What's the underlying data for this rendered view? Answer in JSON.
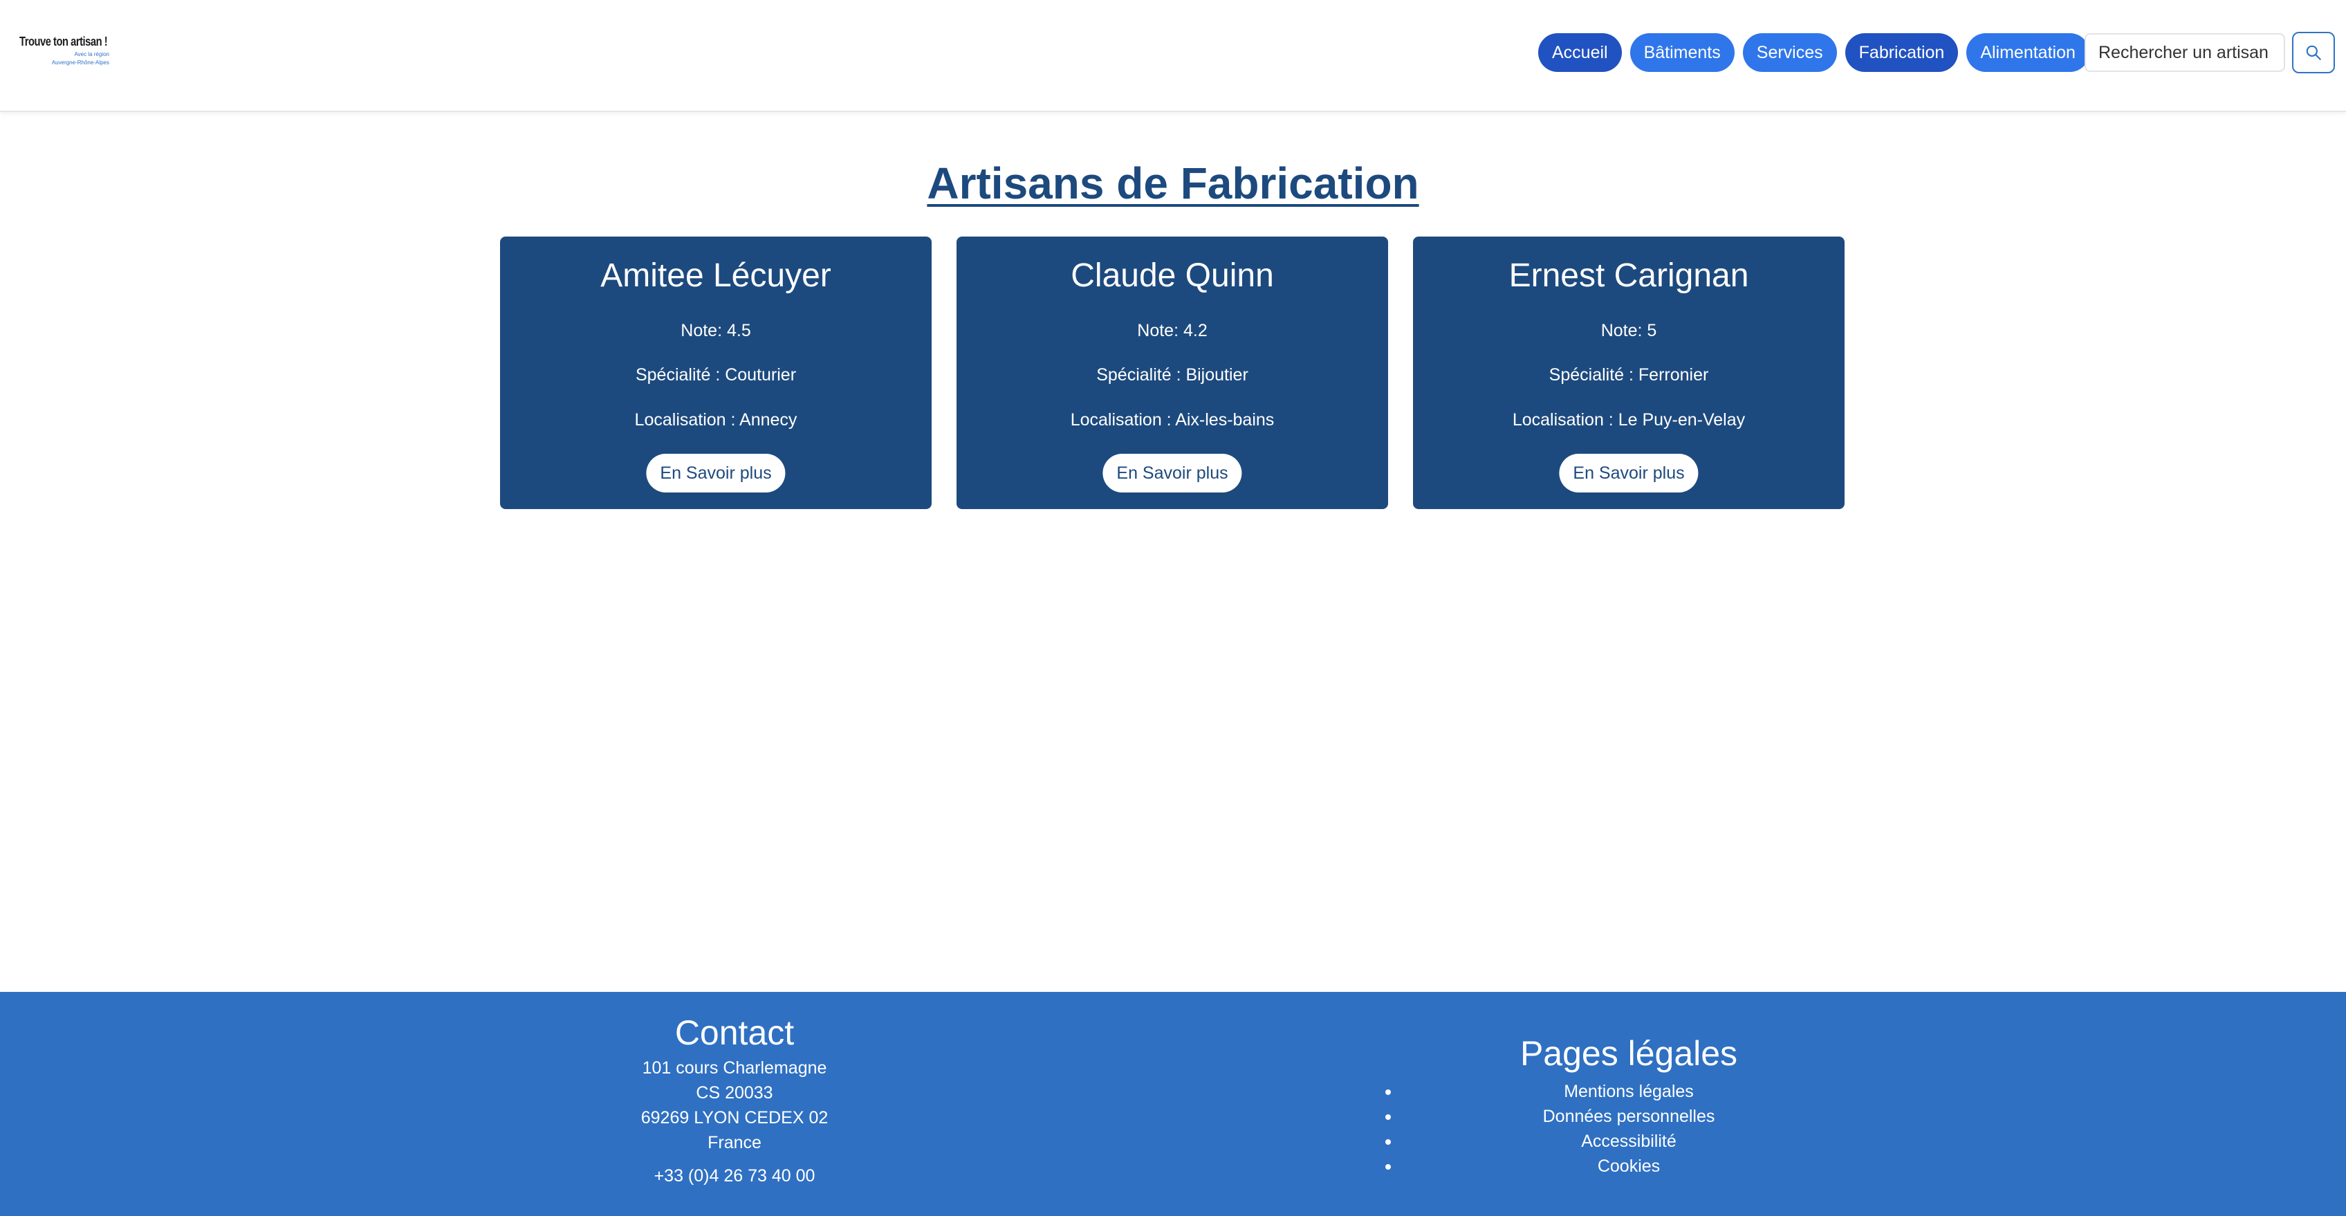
{
  "logo": {
    "title": "Trouve ton artisan !",
    "line1": "Avec la région",
    "line2": "Auvergne-Rhône-Alpes"
  },
  "nav": {
    "items": [
      {
        "label": "Accueil",
        "color": "#2152c1"
      },
      {
        "label": "Bâtiments",
        "color": "#2f76ea"
      },
      {
        "label": "Services",
        "color": "#2f76ea"
      },
      {
        "label": "Fabrication",
        "color": "#2152c1"
      },
      {
        "label": "Alimentation",
        "color": "#2f76ea"
      }
    ]
  },
  "search": {
    "placeholder": "Rechercher un artisan",
    "button_icon": "search-icon"
  },
  "main": {
    "title": "Artisans de Fabrication",
    "cards": [
      {
        "name": "Amitee Lécuyer",
        "note": "Note: 4.5",
        "speciality": "Spécialité : Couturier",
        "location": "Localisation : Annecy",
        "button": "En Savoir plus"
      },
      {
        "name": "Claude Quinn",
        "note": "Note: 4.2",
        "speciality": "Spécialité : Bijoutier",
        "location": "Localisation : Aix-les-bains",
        "button": "En Savoir plus"
      },
      {
        "name": "Ernest Carignan",
        "note": "Note: 5",
        "speciality": "Spécialité : Ferronier",
        "location": "Localisation : Le Puy-en-Velay",
        "button": "En Savoir plus"
      }
    ]
  },
  "footer": {
    "contact": {
      "title": "Contact",
      "lines": [
        "101 cours Charlemagne",
        "CS 20033",
        "69269 LYON CEDEX 02",
        "France"
      ],
      "phone": "+33 (0)4 26 73 40 00"
    },
    "legal": {
      "title": "Pages légales",
      "items": [
        "Mentions légales",
        "Données personnelles",
        "Accessibilité",
        "Cookies"
      ]
    }
  },
  "colors": {
    "primary_dark": "#1d4a7e",
    "nav_active": "#2152c1",
    "nav_default": "#2f76ea",
    "footer_bg": "#2f70c2"
  }
}
